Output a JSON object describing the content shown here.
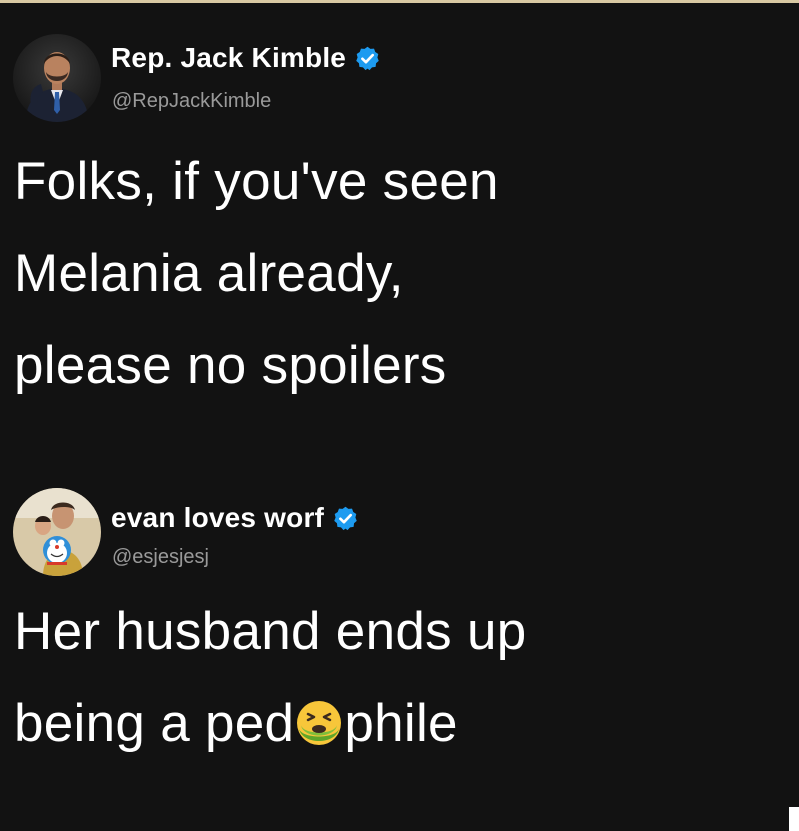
{
  "colors": {
    "background": "#121212",
    "text": "#ffffff",
    "handle": "#9a9a9a",
    "verified": "#1d9bf0",
    "top_edge": "#d9c9a3"
  },
  "tweets": [
    {
      "display_name": "Rep. Jack Kimble",
      "handle": "@RepJackKimble",
      "verified": true,
      "avatar": "avatar-man-in-suit",
      "body_lines": [
        "Folks, if you've seen",
        "Melania already,",
        "please no spoilers"
      ]
    },
    {
      "display_name": "evan loves worf",
      "handle": "@esjesjesj",
      "verified": true,
      "avatar": "avatar-person-with-doraemon",
      "body_lines": [
        "Her husband ends up"
      ],
      "body_last_before": "being a ped",
      "body_last_emoji": "nauseated-face-icon",
      "body_last_after": "phile"
    }
  ]
}
